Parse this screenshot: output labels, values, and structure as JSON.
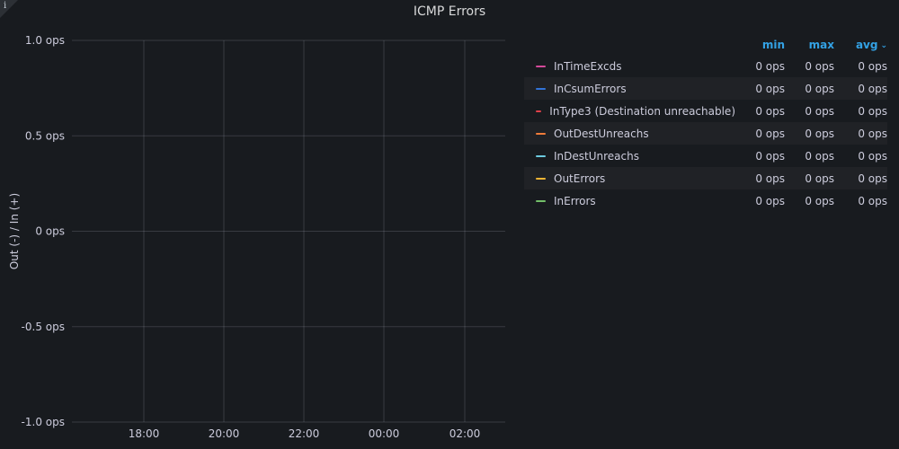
{
  "panel": {
    "title": "ICMP Errors",
    "info_icon": "i"
  },
  "chart_data": {
    "type": "line",
    "title": "ICMP Errors",
    "xlabel": "",
    "ylabel": "Out (-) / In (+)",
    "x_ticks": [
      "18:00",
      "20:00",
      "22:00",
      "00:00",
      "02:00"
    ],
    "y_ticks": [
      {
        "value": 1.0,
        "label": "1.0 ops"
      },
      {
        "value": 0.5,
        "label": "0.5 ops"
      },
      {
        "value": 0,
        "label": "0 ops"
      },
      {
        "value": -0.5,
        "label": "-0.5 ops"
      },
      {
        "value": -1.0,
        "label": "-1.0 ops"
      }
    ],
    "ylim": [
      -1.0,
      1.0
    ],
    "grid": true,
    "legend_placement": "right",
    "series": [
      {
        "name": "InTimeExcds",
        "color": "#d44a9a",
        "values": []
      },
      {
        "name": "InCsumErrors",
        "color": "#3274d9",
        "values": []
      },
      {
        "name": "InType3 (Destination unreachable)",
        "color": "#e0414a",
        "values": []
      },
      {
        "name": "OutDestUnreachs",
        "color": "#f07c3a",
        "values": []
      },
      {
        "name": "InDestUnreachs",
        "color": "#6ccbe0",
        "values": []
      },
      {
        "name": "OutErrors",
        "color": "#f2b635",
        "values": []
      },
      {
        "name": "InErrors",
        "color": "#73bf69",
        "values": []
      }
    ]
  },
  "legend": {
    "columns": {
      "min": "min",
      "max": "max",
      "avg": "avg"
    },
    "sort_icon": "chevron-down-icon",
    "rows": [
      {
        "name": "InTimeExcds",
        "color": "#d44a9a",
        "min": "0 ops",
        "max": "0 ops",
        "avg": "0 ops"
      },
      {
        "name": "InCsumErrors",
        "color": "#3274d9",
        "min": "0 ops",
        "max": "0 ops",
        "avg": "0 ops"
      },
      {
        "name": "InType3 (Destination unreachable)",
        "color": "#e0414a",
        "min": "0 ops",
        "max": "0 ops",
        "avg": "0 ops"
      },
      {
        "name": "OutDestUnreachs",
        "color": "#f07c3a",
        "min": "0 ops",
        "max": "0 ops",
        "avg": "0 ops"
      },
      {
        "name": "InDestUnreachs",
        "color": "#6ccbe0",
        "min": "0 ops",
        "max": "0 ops",
        "avg": "0 ops"
      },
      {
        "name": "OutErrors",
        "color": "#f2b635",
        "min": "0 ops",
        "max": "0 ops",
        "avg": "0 ops"
      },
      {
        "name": "InErrors",
        "color": "#73bf69",
        "min": "0 ops",
        "max": "0 ops",
        "avg": "0 ops"
      }
    ]
  }
}
